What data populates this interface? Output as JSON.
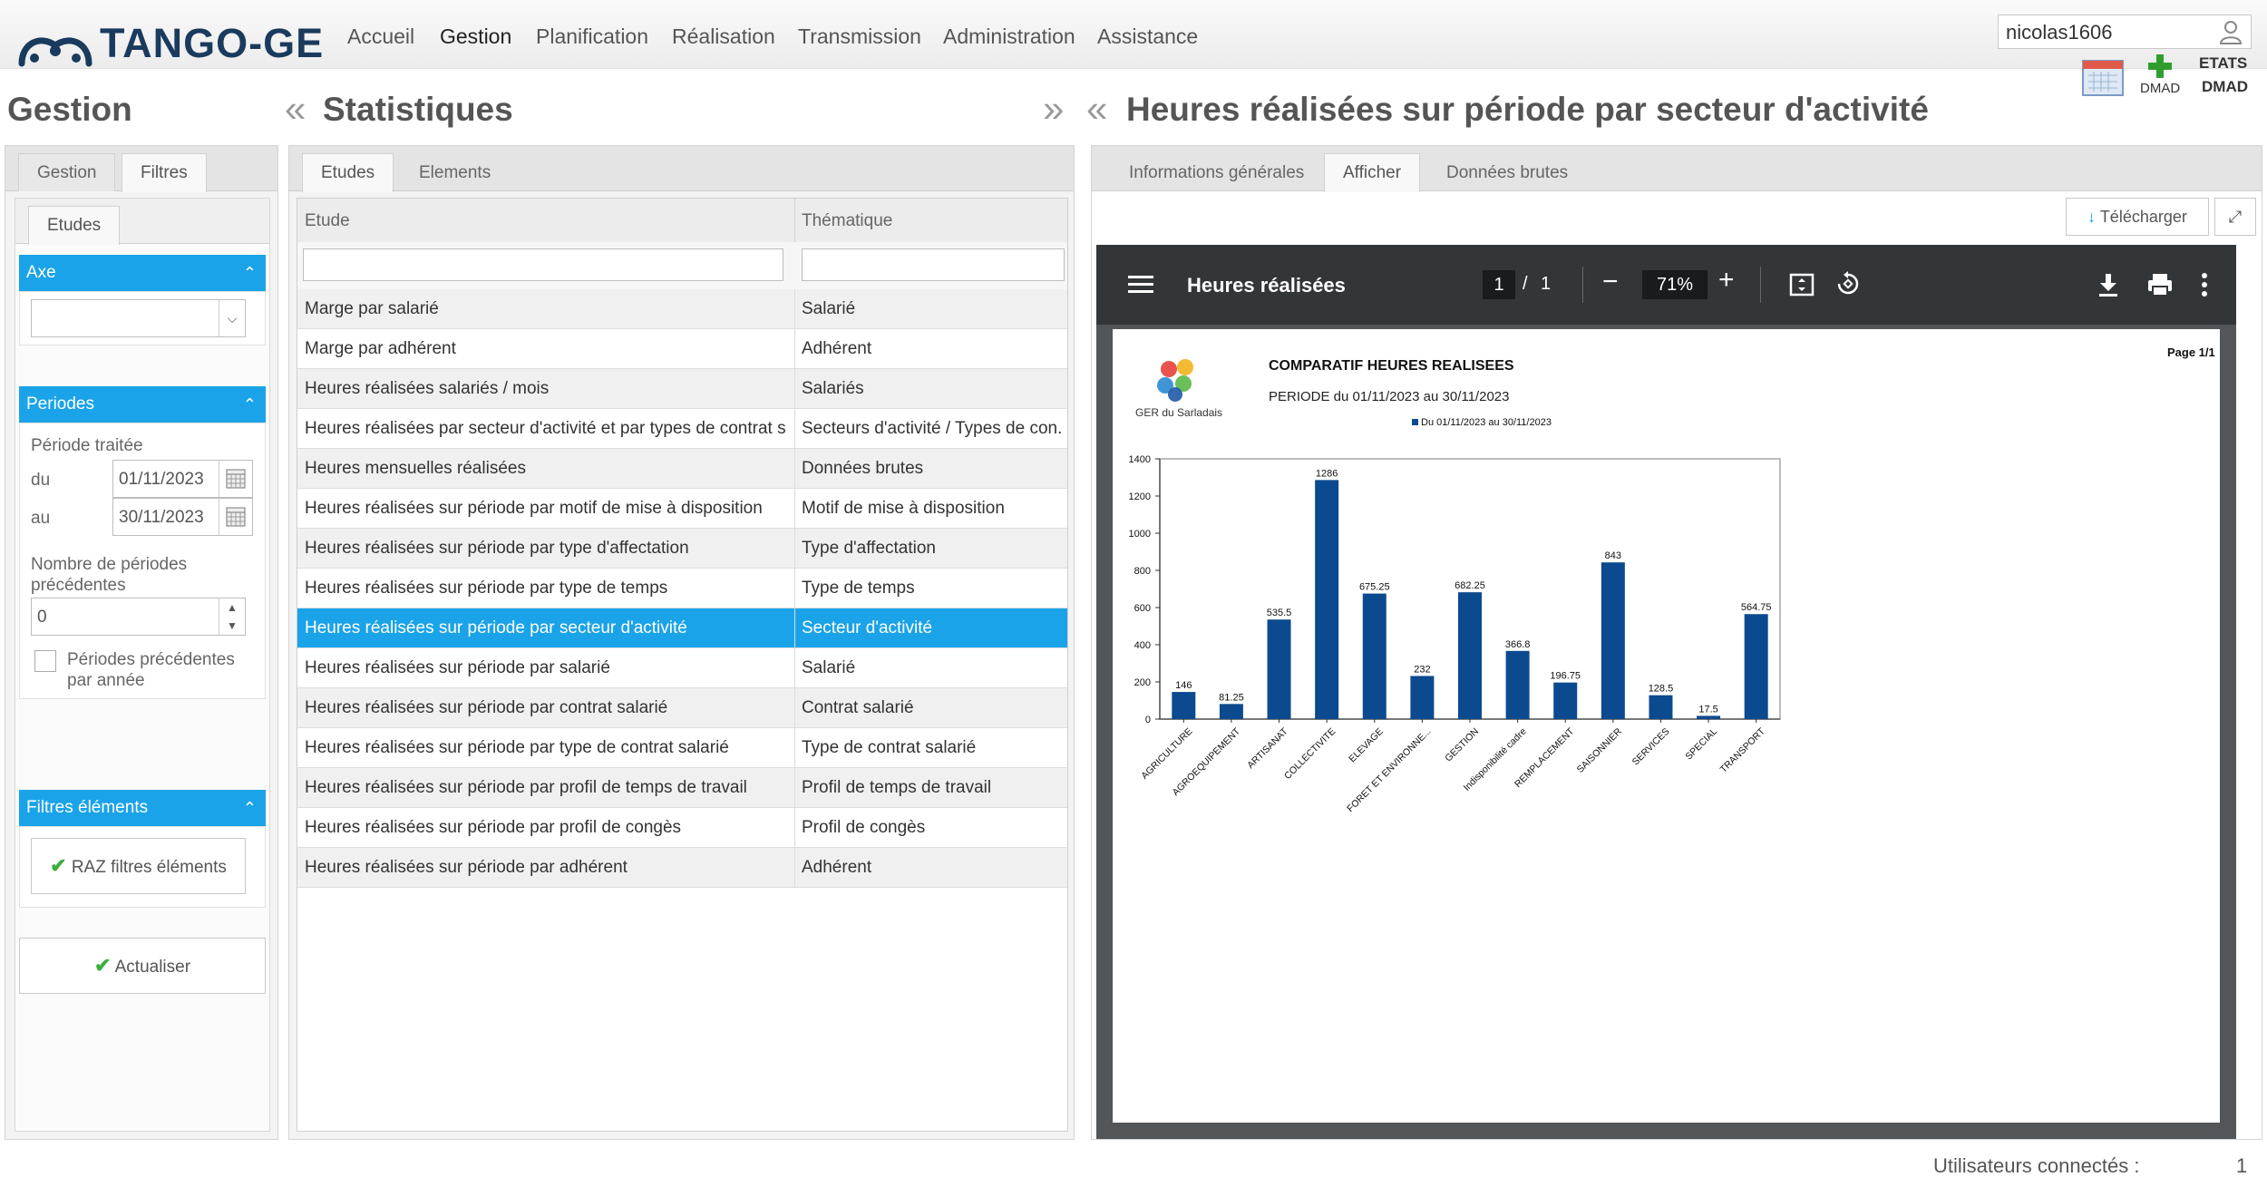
{
  "app": {
    "logo": "TANGO-GE",
    "nav": [
      "Accueil",
      "Gestion",
      "Planification",
      "Réalisation",
      "Transmission",
      "Administration",
      "Assistance"
    ],
    "nav_active": "Gestion",
    "user": "nicolas1606",
    "dmad_label": "DMAD",
    "etats_label": "ETATS",
    "etats_dmad_label": "DMAD"
  },
  "gestion": {
    "title": "Gestion",
    "tabs": [
      "Gestion",
      "Filtres"
    ],
    "active_tab": "Filtres",
    "subtab": "Etudes",
    "axe": {
      "header": "Axe",
      "value": ""
    },
    "periodes": {
      "header": "Periodes",
      "periode_label": "Période traitée",
      "du_label": "du",
      "du_value": "01/11/2023",
      "au_label": "au",
      "au_value": "30/11/2023",
      "nb_label_1": "Nombre de périodes",
      "nb_label_2": "précédentes",
      "nb_value": "0",
      "check_label_1": "Périodes précédentes",
      "check_label_2": "par année"
    },
    "filtres": {
      "header": "Filtres éléments",
      "raz_label": "RAZ filtres éléments"
    },
    "actualiser_label": "Actualiser"
  },
  "statistiques": {
    "title": "Statistiques",
    "tabs": [
      "Etudes",
      "Elements"
    ],
    "active_tab": "Etudes",
    "columns": [
      "Etude",
      "Thématique"
    ],
    "rows": [
      [
        "Marge par salarié",
        "Salarié"
      ],
      [
        "Marge par adhérent",
        "Adhérent"
      ],
      [
        "Heures réalisées salariés / mois",
        "Salariés"
      ],
      [
        "Heures réalisées par secteur d'activité et par types de contrat s...",
        "Secteurs d'activité / Types de con..."
      ],
      [
        "Heures mensuelles réalisées",
        "Données brutes"
      ],
      [
        "Heures réalisées sur période par motif de mise à disposition",
        "Motif de mise à disposition"
      ],
      [
        "Heures réalisées sur période par type d'affectation",
        "Type d'affectation"
      ],
      [
        "Heures réalisées sur période par type de temps",
        "Type de temps"
      ],
      [
        "Heures réalisées sur période par secteur d'activité",
        "Secteur d'activité"
      ],
      [
        "Heures réalisées sur période par salarié",
        "Salarié"
      ],
      [
        "Heures réalisées sur période par contrat salarié",
        "Contrat salarié"
      ],
      [
        "Heures réalisées sur période par type de contrat salarié",
        "Type de contrat salarié"
      ],
      [
        "Heures réalisées sur période par profil de temps de travail",
        "Profil de temps de travail"
      ],
      [
        "Heures réalisées sur période par profil de congès",
        "Profil de congès"
      ],
      [
        "Heures réalisées sur période par adhérent",
        "Adhérent"
      ]
    ],
    "selected_row": 8
  },
  "detail": {
    "title": "Heures réalisées sur période par secteur d'activité",
    "tabs": [
      "Informations générales",
      "Afficher",
      "Données brutes"
    ],
    "active_tab": "Afficher",
    "download_label": "Télécharger",
    "pdf": {
      "title": "Heures réalisées",
      "page_current": "1",
      "page_sep": "/",
      "page_total": "1",
      "zoom": "71%",
      "report_title": "COMPARATIF HEURES REALISEES",
      "report_period": "PERIODE du 01/11/2023 au 30/11/2023",
      "page_label": "Page 1/1",
      "org_name": "GER du Sarladais"
    }
  },
  "status": {
    "label": "Utilisateurs connectés :",
    "count": "1"
  },
  "colors": {
    "accent": "#1aa3e8",
    "bar": "#0b4a8f",
    "logo": "#1a3a5e"
  },
  "chart_data": {
    "type": "bar",
    "categories": [
      "AGRICULTURE",
      "AGROEQUIPEMENT",
      "ARTISANAT",
      "COLLECTIVITE",
      "ELEVAGE",
      "FORET ET ENVIRONNE...",
      "GESTION",
      "Indisponibilité cadre",
      "REMPLACEMENT",
      "SAISONNIER",
      "SERVICES",
      "SPECIAL",
      "TRANSPORT"
    ],
    "series": [
      {
        "name": "Du 01/11/2023 au 30/11/2023",
        "values": [
          146,
          81.25,
          535.5,
          1286,
          675.25,
          232,
          682.25,
          366.8,
          196.75,
          843,
          128.5,
          17.5,
          564.75
        ]
      }
    ],
    "data_labels": [
      "146",
      "81.25",
      "535.5",
      "1286",
      "675.25",
      "232",
      "682.25",
      "366.8",
      "196.75",
      "843",
      "128.5",
      "17.5",
      "564.75"
    ],
    "y_ticks": [
      "0",
      "200",
      "400",
      "600",
      "800",
      "1000",
      "1200",
      "1400"
    ],
    "ylim": [
      0,
      1400
    ],
    "grid": false,
    "legend": "top"
  }
}
